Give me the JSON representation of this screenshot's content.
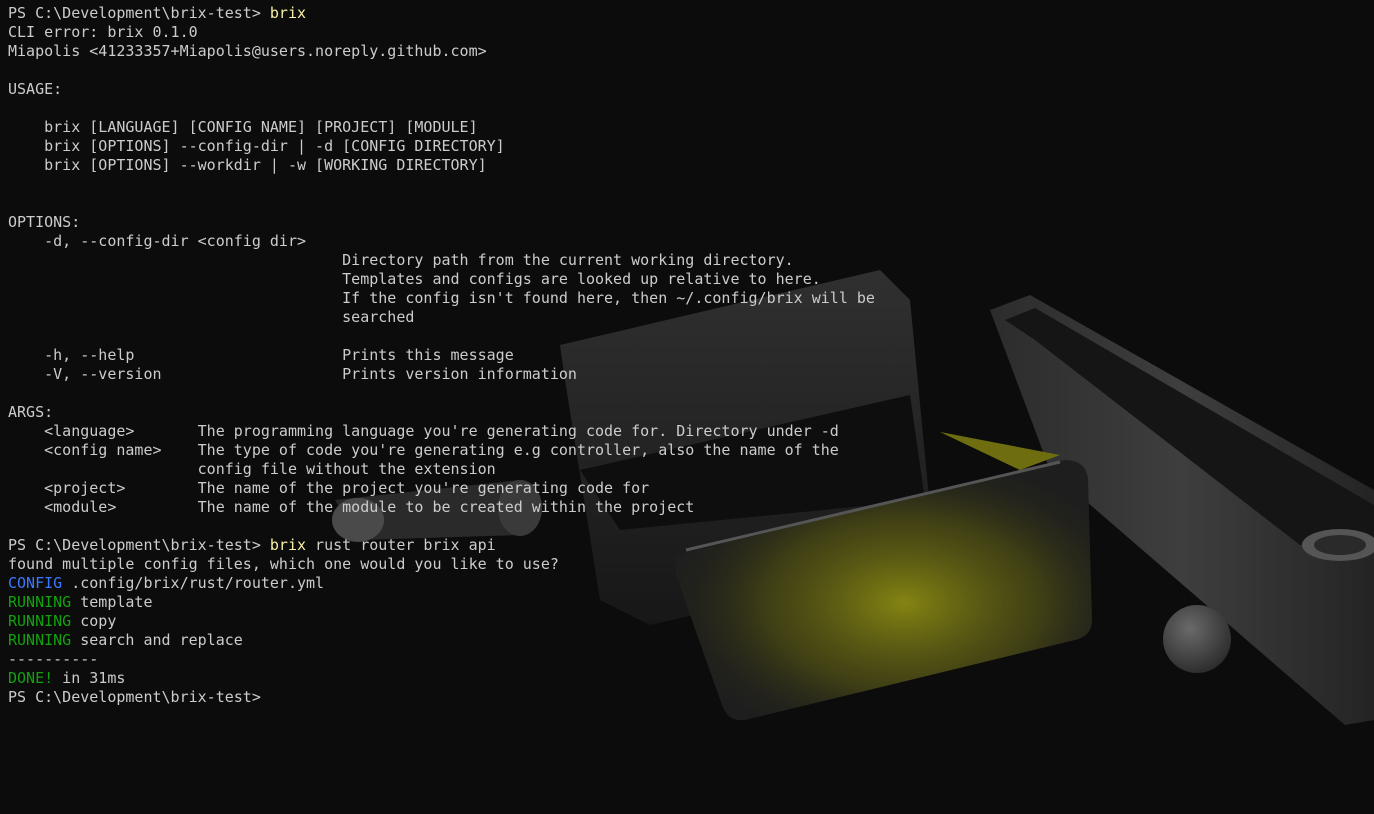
{
  "terminal": {
    "prompt": "PS C:\\Development\\brix-test> ",
    "command_1": "brix",
    "command_2_name": "brix",
    "command_2_args": " rust router brix api",
    "lines": {
      "err_version": "CLI error: brix 0.1.0",
      "author": "Miapolis <41233357+Miapolis@users.noreply.github.com>",
      "usage_header": "USAGE:",
      "usage_1": "    brix [LANGUAGE] [CONFIG NAME] [PROJECT] [MODULE]",
      "usage_2": "    brix [OPTIONS] --config-dir | -d [CONFIG DIRECTORY]",
      "usage_3": "    brix [OPTIONS] --workdir | -w [WORKING DIRECTORY]",
      "options_header": "OPTIONS:",
      "opt_configdir": "    -d, --config-dir <config dir>",
      "opt_configdir_desc_1": "                                     Directory path from the current working directory.",
      "opt_configdir_desc_2": "                                     Templates and configs are looked up relative to here.",
      "opt_configdir_desc_3": "                                     If the config isn't found here, then ~/.config/brix will be",
      "opt_configdir_desc_4": "                                     searched",
      "opt_help": "    -h, --help                       Prints this message",
      "opt_version": "    -V, --version                    Prints version information",
      "args_header": "ARGS:",
      "arg_language": "    <language>       The programming language you're generating code for. Directory under -d",
      "arg_config_1": "    <config name>    The type of code you're generating e.g controller, also the name of the",
      "arg_config_2": "                     config file without the extension",
      "arg_project": "    <project>        The name of the project you're generating code for",
      "arg_module": "    <module>         The name of the module to be created within the project",
      "found_multiple": "found multiple config files, which one would you like to use?",
      "config_tag": "CONFIG",
      "config_path": " .config/brix/rust/router.yml",
      "running_tag": "RUNNING",
      "running_1": " template",
      "running_2": " copy",
      "running_3": " search and replace",
      "separator": "----------",
      "done_tag": "DONE!",
      "done_time": " in 31ms"
    }
  },
  "colors": {
    "background": "#0c0c0c",
    "foreground": "#cccccc",
    "command": "#f9f1a5",
    "config_blue": "#3b78ff",
    "status_green": "#13a10e"
  }
}
